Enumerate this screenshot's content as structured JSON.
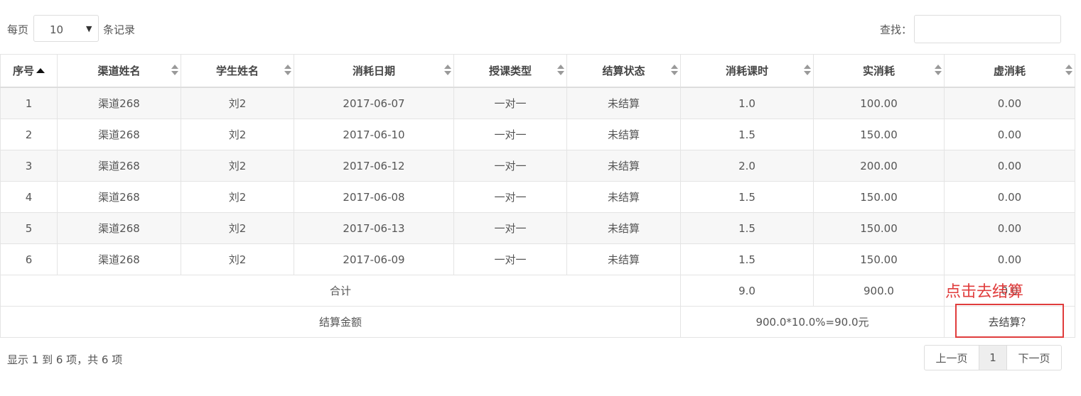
{
  "length_control": {
    "prefix": "每页",
    "value": "10",
    "suffix": "条记录"
  },
  "search": {
    "label": "查找：",
    "value": "",
    "placeholder": ""
  },
  "table": {
    "columns": [
      "序号",
      "渠道姓名",
      "学生姓名",
      "消耗日期",
      "授课类型",
      "结算状态",
      "消耗课时",
      "实消耗",
      "虚消耗"
    ],
    "rows": [
      [
        "1",
        "渠道268",
        "刘2",
        "2017-06-07",
        "一对一",
        "未结算",
        "1.0",
        "100.00",
        "0.00"
      ],
      [
        "2",
        "渠道268",
        "刘2",
        "2017-06-10",
        "一对一",
        "未结算",
        "1.5",
        "150.00",
        "0.00"
      ],
      [
        "3",
        "渠道268",
        "刘2",
        "2017-06-12",
        "一对一",
        "未结算",
        "2.0",
        "200.00",
        "0.00"
      ],
      [
        "4",
        "渠道268",
        "刘2",
        "2017-06-08",
        "一对一",
        "未结算",
        "1.5",
        "150.00",
        "0.00"
      ],
      [
        "5",
        "渠道268",
        "刘2",
        "2017-06-13",
        "一对一",
        "未结算",
        "1.5",
        "150.00",
        "0.00"
      ],
      [
        "6",
        "渠道268",
        "刘2",
        "2017-06-09",
        "一对一",
        "未结算",
        "1.5",
        "150.00",
        "0.00"
      ]
    ],
    "total": {
      "label": "合计",
      "hours": "9.0",
      "actual": "900.0",
      "virtual": "0.0"
    },
    "settlement": {
      "label": "结算金额",
      "formula": "900.0*10.0%=90.0元",
      "button": "去结算？"
    }
  },
  "annotation": {
    "text": "点击去结算",
    "color": "#e03c3c"
  },
  "footer": {
    "info": "显示 1 到 6 项，共 6 项",
    "prev": "上一页",
    "current_page": "1",
    "next": "下一页"
  }
}
